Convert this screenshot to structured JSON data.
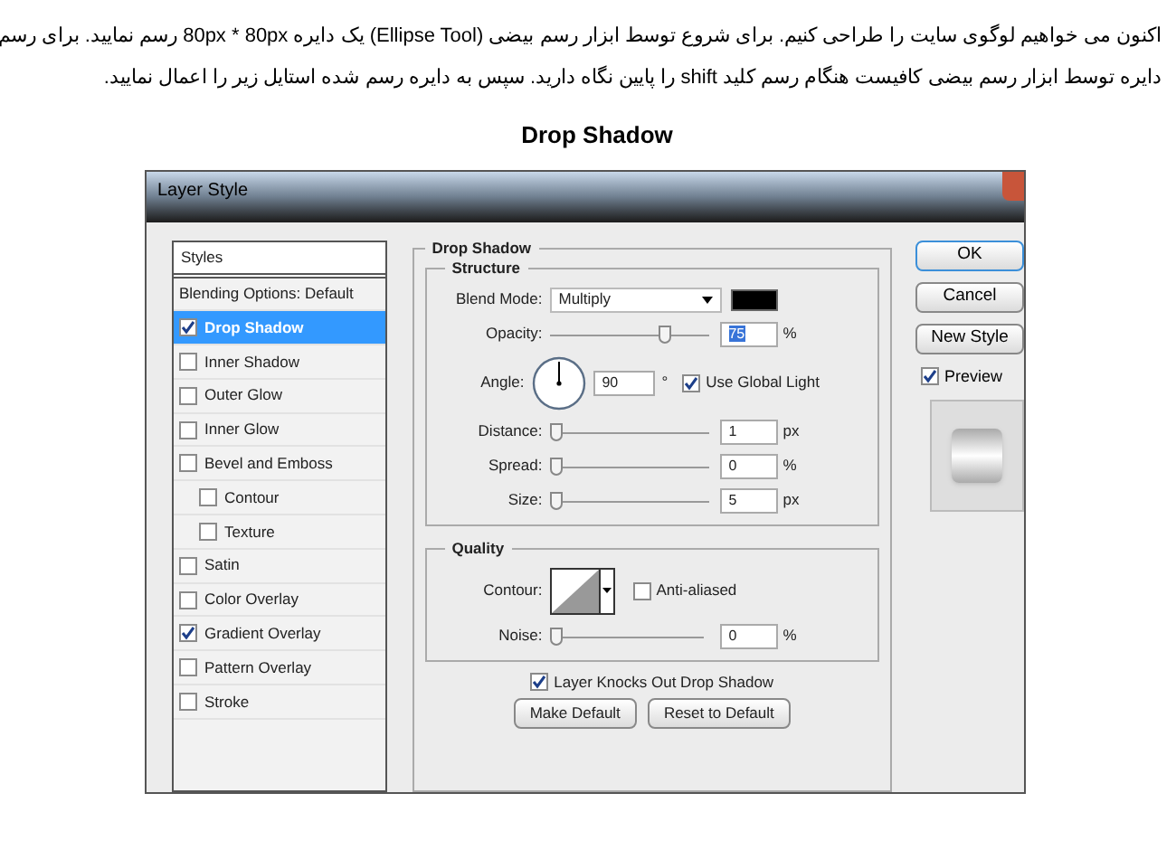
{
  "article": {
    "paragraph_lines": [
      "اکنون می خواهیم لوگوی سایت را طراحی کنیم. برای شروع توسط ابزار رسم بیضی (Ellipse Tool) یک دایره 80px * 80px رسم نمایید. برای رسم",
      "دایره توسط ابزار رسم بیضی کافیست هنگام رسم کلید  shift را پایین نگاه دارید. سپس به دایره رسم شده استایل زیر را اعمال نمایید."
    ],
    "heading": "Drop Shadow"
  },
  "dialog": {
    "title": "Layer Style",
    "styles": [
      {
        "label": "Styles",
        "kind": "header"
      },
      {
        "label": "Blending Options: Default",
        "kind": "option",
        "selected": false
      },
      {
        "label": "Drop Shadow",
        "kind": "check",
        "checked": true,
        "selected": true
      },
      {
        "label": "Inner Shadow",
        "kind": "check",
        "checked": false,
        "selected": false
      },
      {
        "label": "Outer Glow",
        "kind": "check",
        "checked": false,
        "selected": false
      },
      {
        "label": "Inner Glow",
        "kind": "check",
        "checked": false,
        "selected": false
      },
      {
        "label": "Bevel and Emboss",
        "kind": "check",
        "checked": false,
        "selected": false
      },
      {
        "label": "Contour",
        "kind": "subcheck",
        "checked": false,
        "selected": false
      },
      {
        "label": "Texture",
        "kind": "subcheck",
        "checked": false,
        "selected": false
      },
      {
        "label": "Satin",
        "kind": "check",
        "checked": false,
        "selected": false
      },
      {
        "label": "Color Overlay",
        "kind": "check",
        "checked": false,
        "selected": false
      },
      {
        "label": "Gradient Overlay",
        "kind": "check",
        "checked": true,
        "selected": false
      },
      {
        "label": "Pattern Overlay",
        "kind": "check",
        "checked": false,
        "selected": false
      },
      {
        "label": "Stroke",
        "kind": "check",
        "checked": false,
        "selected": false
      }
    ],
    "section_title": "Drop Shadow",
    "structure": {
      "title": "Structure",
      "blend_mode_label": "Blend Mode:",
      "blend_mode": "Multiply",
      "opacity": {
        "label": "Opacity:",
        "level": 0.75,
        "value": "75",
        "unit": "%"
      },
      "angle": {
        "label": "Angle:",
        "value": "90",
        "unit": "°"
      },
      "use_global_light": {
        "label": "Use Global Light",
        "checked": true
      },
      "sliders": [
        {
          "label": "Distance:",
          "level": 0,
          "value": "1",
          "unit": "px"
        },
        {
          "label": "Spread:",
          "level": 0,
          "value": "0",
          "unit": "%"
        },
        {
          "label": "Size:",
          "level": 0,
          "value": "5",
          "unit": "px"
        }
      ]
    },
    "quality": {
      "title": "Quality",
      "contour_label": "Contour:",
      "anti_aliased": {
        "label": "Anti-aliased",
        "checked": false
      },
      "noise": {
        "label": "Noise:",
        "level": 0,
        "value": "0",
        "unit": "%"
      }
    },
    "knocks_out": {
      "label": "Layer Knocks Out Drop Shadow",
      "checked": true
    },
    "buttons": [
      "Make Default",
      "Reset to Default"
    ],
    "side_buttons": [
      "OK",
      "Cancel",
      "New Style"
    ],
    "preview": {
      "label": "Preview",
      "checked": true
    }
  }
}
